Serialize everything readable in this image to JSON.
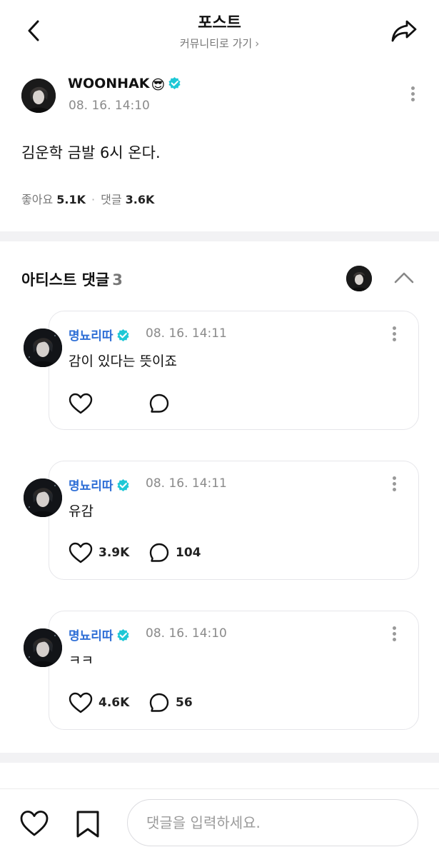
{
  "header": {
    "title": "포스트",
    "subtitle": "커뮤니티로 가기"
  },
  "post": {
    "author": "WOONHAK",
    "author_emoji": "😎",
    "date": "08. 16. 14:10",
    "text": "김운학 금발 6시 온다.",
    "likes_label": "좋아요",
    "likes": "5.1K",
    "comments_label": "댓글",
    "comments": "3.6K"
  },
  "artist_comments": {
    "title": "아티스트 댓글",
    "count": "3",
    "items": [
      {
        "author": "명뇨리따",
        "date": "08. 16. 14:11",
        "text": "감이 있다는 뜻이죠",
        "likes": "",
        "replies": ""
      },
      {
        "author": "명뇨리따",
        "date": "08. 16. 14:11",
        "text": "유감",
        "likes": "3.9K",
        "replies": "104"
      },
      {
        "author": "명뇨리따",
        "date": "08. 16. 14:10",
        "text": "ㅋㅋ",
        "likes": "4.6K",
        "replies": "56"
      }
    ]
  },
  "composer": {
    "placeholder": "댓글을 입력하세요."
  },
  "colors": {
    "verified": "#1ec8d6",
    "commenter_name": "#2f6fd6",
    "divider": "#f2f2f4"
  },
  "icons": [
    "back-arrow-icon",
    "share-icon",
    "verified-badge-icon",
    "more-icon",
    "chevron-up-icon",
    "heart-icon",
    "comment-bubble-icon",
    "bookmark-icon"
  ]
}
